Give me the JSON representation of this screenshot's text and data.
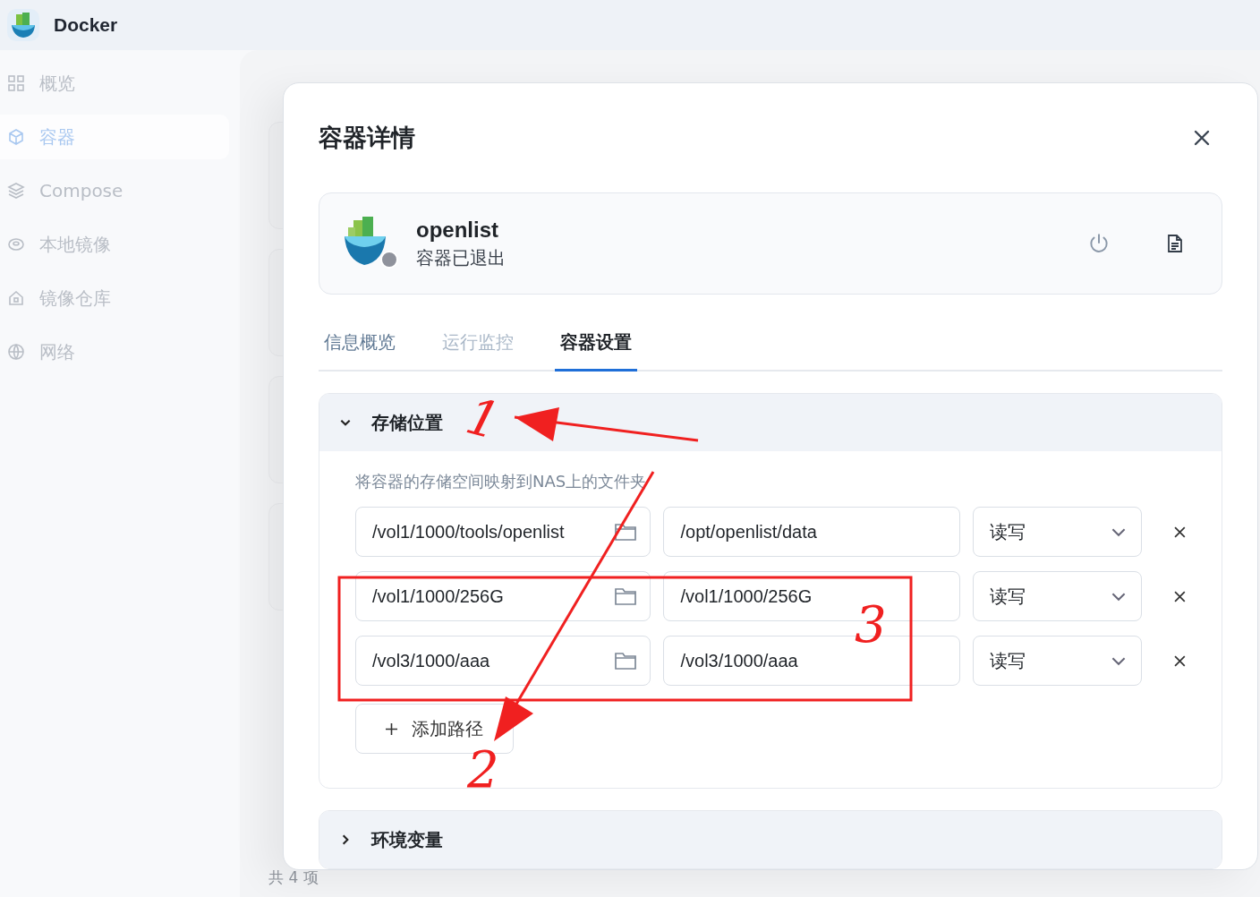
{
  "app": {
    "title": "Docker"
  },
  "sidebar": {
    "items": [
      {
        "label": "概览",
        "kind": "grid",
        "selected": false
      },
      {
        "label": "容器",
        "kind": "cube",
        "selected": true
      },
      {
        "label": "Compose",
        "kind": "layers",
        "selected": false
      },
      {
        "label": "本地镜像",
        "kind": "disc",
        "selected": false
      },
      {
        "label": "镜像仓库",
        "kind": "house",
        "selected": false
      },
      {
        "label": "网络",
        "kind": "globe",
        "selected": false
      }
    ]
  },
  "list_footer": "共 4 项",
  "modal": {
    "title": "容器详情",
    "container": {
      "name": "openlist",
      "status": "容器已退出",
      "running": false
    },
    "tabs": [
      {
        "label": "信息概览",
        "selected": false,
        "disabled": false
      },
      {
        "label": "运行监控",
        "selected": false,
        "disabled": true
      },
      {
        "label": "容器设置",
        "selected": true,
        "disabled": false
      }
    ],
    "sections": [
      {
        "title": "存储位置",
        "expanded": true,
        "description": "将容器的存储空间映射到NAS上的文件夹",
        "mounts": [
          {
            "host_path": "/vol1/1000/tools/openlist",
            "container_path": "/opt/openlist/data",
            "mode": "读写"
          },
          {
            "host_path": "/vol1/1000/256G",
            "container_path": "/vol1/1000/256G",
            "mode": "读写"
          },
          {
            "host_path": "/vol3/1000/aaa",
            "container_path": "/vol3/1000/aaa",
            "mode": "读写"
          }
        ],
        "add_button": "添加路径"
      },
      {
        "title": "环境变量",
        "expanded": false
      }
    ]
  },
  "annotations": [
    {
      "kind": "arrow"
    },
    {
      "kind": "arrow"
    },
    {
      "kind": "box"
    },
    {
      "kind": "number",
      "text": "1"
    },
    {
      "kind": "number",
      "text": "2"
    },
    {
      "kind": "number",
      "text": "3"
    }
  ]
}
